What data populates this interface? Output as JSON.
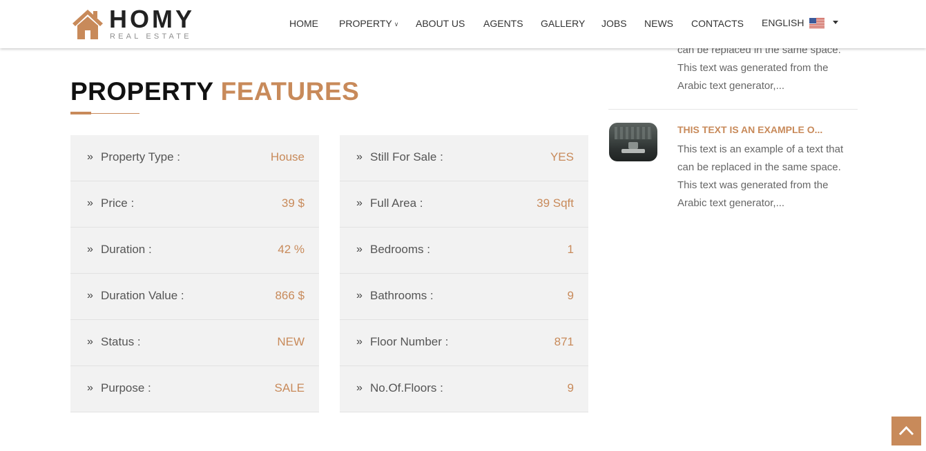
{
  "header": {
    "logo_word": "HOMY",
    "logo_sub": "REAL ESTATE",
    "nav": {
      "home": "HOME",
      "property": "PROPERTY",
      "about": "ABOUT US",
      "agents": "AGENTS",
      "gallery": "GALLERY",
      "jobs": "JOBS",
      "news": "NEWS",
      "contacts": "CONTACTS",
      "language": "ENGLISH"
    }
  },
  "section": {
    "title_main": "PROPERTY",
    "title_accent": "FEATURES"
  },
  "features_left": [
    {
      "label": "Property Type :",
      "value": "House"
    },
    {
      "label": "Price :",
      "value": "39 $"
    },
    {
      "label": "Duration :",
      "value": "42 %"
    },
    {
      "label": "Duration Value :",
      "value": "866 $"
    },
    {
      "label": "Status :",
      "value": "NEW"
    },
    {
      "label": "Purpose :",
      "value": "SALE"
    }
  ],
  "features_right": [
    {
      "label": "Still For Sale :",
      "value": "YES"
    },
    {
      "label": "Full Area :",
      "value": "39 Sqft"
    },
    {
      "label": "Bedrooms :",
      "value": "1"
    },
    {
      "label": "Bathrooms :",
      "value": "9"
    },
    {
      "label": "Floor Number :",
      "value": "871"
    },
    {
      "label": "No.Of.Floors :",
      "value": "9"
    }
  ],
  "sidebar": {
    "items": [
      {
        "text": "can be replaced in the same space. This text was generated from the Arabic text generator,..."
      },
      {
        "title": "THIS TEXT IS AN EXAMPLE O...",
        "text": "This text is an example of a text that can be replaced in the same space. This text was generated from the Arabic text generator,..."
      }
    ]
  },
  "colors": {
    "accent": "#c88a5a",
    "row_bg": "#f2f2f2"
  },
  "icons": {
    "row_bullet": "double-chevron-right-icon",
    "scroll_top": "chevron-up-icon",
    "language_flag": "us-flag-icon"
  }
}
